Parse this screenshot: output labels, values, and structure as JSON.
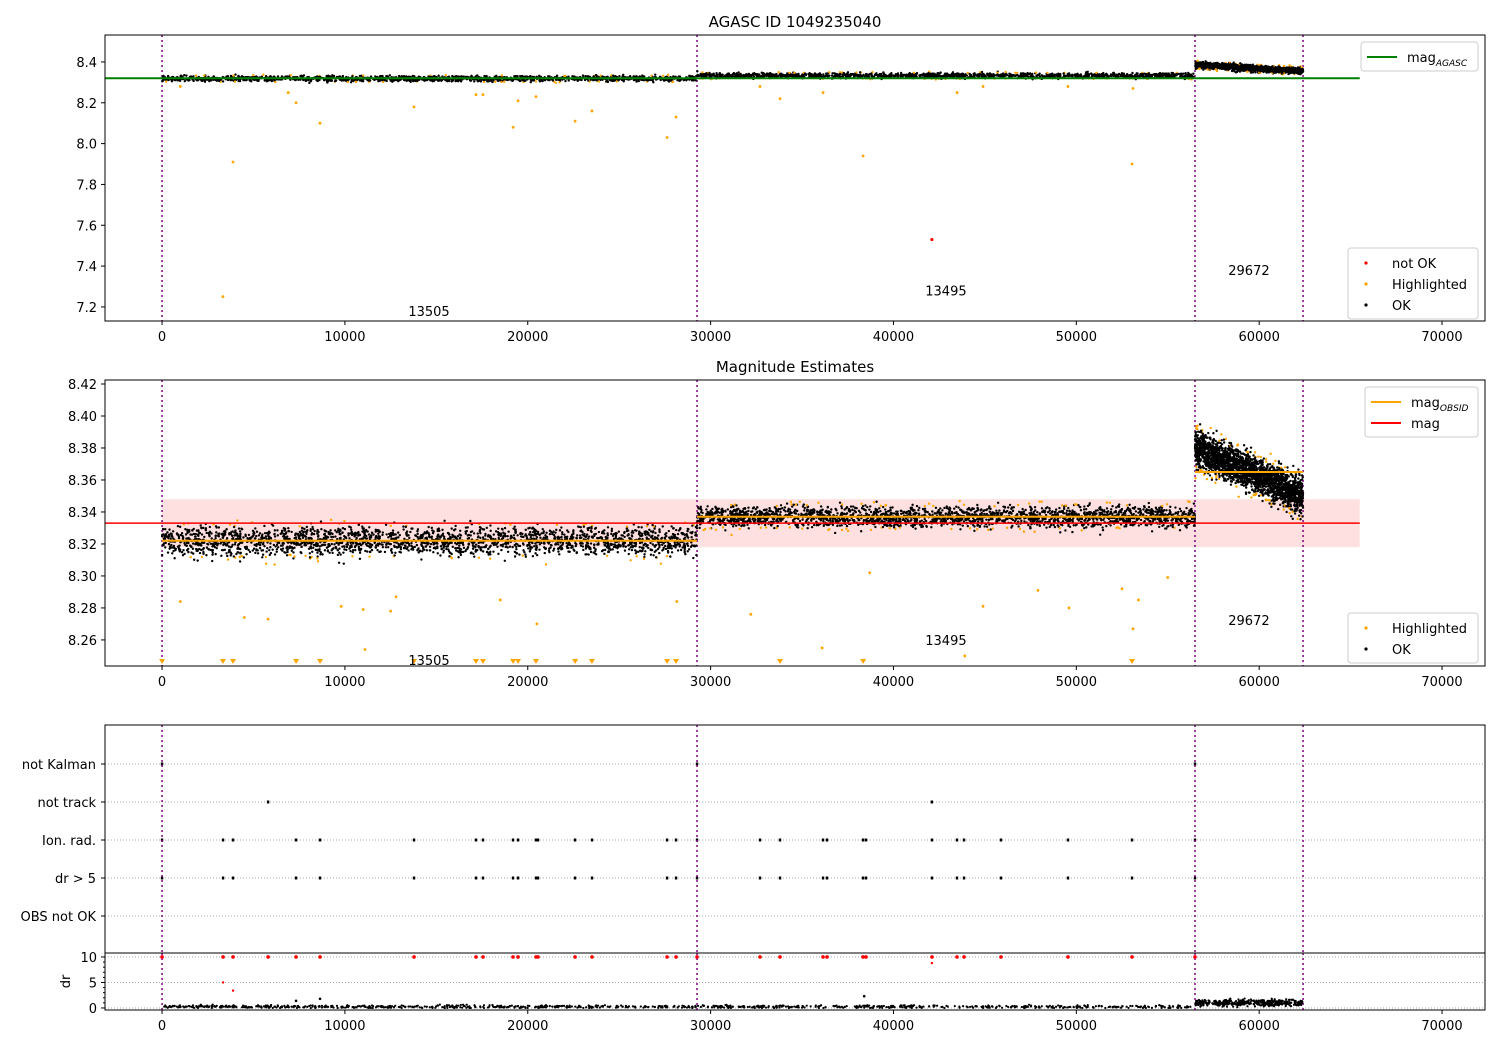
{
  "chart_data": [
    {
      "type": "scatter",
      "title": "AGASC ID 1049235040",
      "xlim": [
        -3120,
        72350
      ],
      "ylim": [
        7.131,
        8.532
      ],
      "xticks": [
        0,
        10000,
        20000,
        30000,
        40000,
        50000,
        60000,
        70000
      ],
      "xtick_labels": [
        "0",
        "10000",
        "20000",
        "30000",
        "40000",
        "50000",
        "60000",
        "70000"
      ],
      "yticks": [
        7.2,
        7.4,
        7.6,
        7.8,
        8.0,
        8.2,
        8.4
      ],
      "ytick_labels": [
        "7.2",
        "7.4",
        "7.6",
        "7.8",
        "8.0",
        "8.2",
        "8.4"
      ],
      "obsid_boundaries": [
        0,
        29257,
        56490,
        62400
      ],
      "obsids": [
        {
          "label": "13505",
          "x": 14600,
          "y": 7.18
        },
        {
          "label": "13495",
          "x": 42870,
          "y": 7.28
        },
        {
          "label": "29672",
          "x": 59440,
          "y": 7.38
        }
      ],
      "segments": [
        {
          "x0": 0,
          "x1": 29257,
          "mean": 8.318,
          "spread": 0.012
        },
        {
          "x0": 29257,
          "x1": 56490,
          "mean": 8.333,
          "spread": 0.012
        },
        {
          "x0": 56490,
          "x1": 62400,
          "mean_start": 8.385,
          "mean_end": 8.355,
          "spread": 0.014
        }
      ],
      "mag_agasc": {
        "value": 8.32,
        "x0": -3120,
        "x1": 65500,
        "color": "#008000"
      },
      "highlighted_outliers": [
        [
          3330,
          7.25
        ],
        [
          3880,
          7.91
        ],
        [
          8640,
          8.1
        ],
        [
          7330,
          8.2
        ],
        [
          19200,
          8.08
        ],
        [
          19470,
          8.21
        ],
        [
          20450,
          8.23
        ],
        [
          22590,
          8.11
        ],
        [
          23510,
          8.16
        ],
        [
          27620,
          8.03
        ],
        [
          28110,
          8.13
        ],
        [
          13780,
          8.18
        ],
        [
          17170,
          8.24
        ],
        [
          17550,
          8.24
        ],
        [
          32700,
          8.28
        ],
        [
          33800,
          8.22
        ],
        [
          36150,
          8.25
        ],
        [
          38340,
          7.94
        ],
        [
          43480,
          8.25
        ],
        [
          44900,
          8.28
        ],
        [
          53050,
          7.9
        ],
        [
          53100,
          8.27
        ],
        [
          49540,
          8.28
        ],
        [
          1000,
          8.28
        ],
        [
          6900,
          8.25
        ]
      ],
      "not_ok_points": [
        [
          42100,
          7.53
        ]
      ],
      "legend_upper": [
        {
          "label": "mag",
          "sub": "AGASC",
          "color": "#008000"
        }
      ],
      "legend_lower": [
        {
          "label": "not OK",
          "color": "#ff0000"
        },
        {
          "label": "Highlighted",
          "color": "#ffa500"
        },
        {
          "label": "OK",
          "color": "#000000"
        }
      ]
    },
    {
      "type": "scatter",
      "title": "Magnitude Estimates",
      "xlim": [
        -3120,
        72350
      ],
      "ylim": [
        8.2437,
        8.4225
      ],
      "xticks": [
        0,
        10000,
        20000,
        30000,
        40000,
        50000,
        60000,
        70000
      ],
      "xtick_labels": [
        "0",
        "10000",
        "20000",
        "30000",
        "40000",
        "50000",
        "60000",
        "70000"
      ],
      "yticks": [
        8.26,
        8.28,
        8.3,
        8.32,
        8.34,
        8.36,
        8.38,
        8.4,
        8.42
      ],
      "ytick_labels": [
        "8.26",
        "8.28",
        "8.30",
        "8.32",
        "8.34",
        "8.36",
        "8.38",
        "8.40",
        "8.42"
      ],
      "obsids": [
        {
          "label": "13505",
          "x": 14600,
          "y": 8.2475
        },
        {
          "label": "13495",
          "x": 42870,
          "y": 8.26
        },
        {
          "label": "29672",
          "x": 59440,
          "y": 8.2725
        }
      ],
      "segments": [
        {
          "x0": 0,
          "x1": 29257,
          "mean": 8.322,
          "spread": 0.008
        },
        {
          "x0": 29257,
          "x1": 56490,
          "mean": 8.337,
          "spread": 0.006
        },
        {
          "x0": 56490,
          "x1": 62400,
          "mean_start": 8.38,
          "mean_end": 8.35,
          "spread": 0.01
        }
      ],
      "mag_obsid": [
        {
          "x0": 0,
          "x1": 29257,
          "value": 8.322
        },
        {
          "x0": 29257,
          "x1": 56490,
          "value": 8.337
        },
        {
          "x0": 56490,
          "x1": 62400,
          "value": 8.365
        }
      ],
      "mag": {
        "value": 8.333,
        "band": [
          8.318,
          8.348
        ],
        "x0": -3120,
        "x1": 65500
      },
      "highlighted_below_range_x": [
        0,
        3330,
        3880,
        7330,
        8640,
        13780,
        17170,
        17550,
        19200,
        19470,
        20450,
        22590,
        23510,
        27620,
        28110,
        33800,
        38340,
        53050
      ],
      "highlighted_outliers": [
        [
          1000,
          8.284
        ],
        [
          4500,
          8.274
        ],
        [
          5800,
          8.273
        ],
        [
          9800,
          8.281
        ],
        [
          11000,
          8.279
        ],
        [
          11100,
          8.254
        ],
        [
          12800,
          8.287
        ],
        [
          12500,
          8.278
        ],
        [
          18500,
          8.285
        ],
        [
          20500,
          8.27
        ],
        [
          32200,
          8.276
        ],
        [
          36100,
          8.255
        ],
        [
          38700,
          8.302
        ],
        [
          43900,
          8.25
        ],
        [
          44900,
          8.281
        ],
        [
          47900,
          8.291
        ],
        [
          49600,
          8.28
        ],
        [
          52500,
          8.292
        ],
        [
          53100,
          8.267
        ],
        [
          53400,
          8.285
        ],
        [
          55000,
          8.299
        ],
        [
          28150,
          8.284
        ]
      ],
      "legend_upper": [
        {
          "label": "mag",
          "sub": "OBSID",
          "color": "#ffa500"
        },
        {
          "label": "mag",
          "sub": "",
          "color": "#ff0000"
        }
      ],
      "legend_lower": [
        {
          "label": "Highlighted",
          "color": "#ffa500"
        },
        {
          "label": "OK",
          "color": "#000000"
        }
      ]
    },
    {
      "type": "scatter",
      "title": "",
      "categories": [
        "not Kalman",
        "not track",
        "Ion. rad.",
        "dr > 5",
        "OBS not OK"
      ],
      "flags": {
        "not Kalman": [
          0,
          29257,
          56490
        ],
        "not track": [
          5800,
          42100
        ],
        "Ion. rad.": [
          0,
          3336,
          3883,
          7328,
          8640,
          13781,
          17171,
          17554,
          19195,
          19468,
          20452,
          20562,
          22586,
          23515,
          27617,
          28109,
          29257,
          32702,
          33796,
          36148,
          36366,
          38335,
          38499,
          42108,
          43475,
          43858,
          45881,
          49545,
          53045,
          56490
        ],
        "dr > 5": [
          0,
          3336,
          3883,
          7328,
          8640,
          13781,
          17171,
          17554,
          19195,
          19468,
          20452,
          20562,
          22586,
          23515,
          27617,
          28109,
          29257,
          32702,
          33796,
          36148,
          36366,
          38335,
          38499,
          42108,
          43475,
          43858,
          45881,
          49545,
          53045,
          56490
        ],
        "OBS not OK": []
      }
    },
    {
      "type": "scatter",
      "ylabel": "dr",
      "ylim": [
        -0.4,
        10.78
      ],
      "yticks": [
        0,
        5,
        10
      ],
      "ytick_labels": [
        "0",
        "5",
        "10"
      ],
      "xticks": [
        0,
        10000,
        20000,
        30000,
        40000,
        50000,
        60000,
        70000
      ],
      "xtick_labels": [
        "0",
        "10000",
        "20000",
        "30000",
        "40000",
        "50000",
        "60000",
        "70000"
      ],
      "clipped_points_x": [
        0,
        3336,
        3883,
        5800,
        7328,
        8640,
        13781,
        17171,
        17554,
        19195,
        19468,
        20452,
        20562,
        22586,
        23515,
        27617,
        28109,
        29257,
        32702,
        33796,
        36148,
        36366,
        38335,
        38499,
        42108,
        43475,
        43858,
        45881,
        49545,
        53045,
        56490
      ],
      "red_points": [
        [
          3336,
          5.0
        ],
        [
          3883,
          3.4
        ],
        [
          42100,
          8.8
        ]
      ],
      "black_outliers": [
        [
          7328,
          1.4
        ],
        [
          8640,
          1.8
        ],
        [
          38400,
          2.3
        ]
      ],
      "segments": [
        {
          "x0": 0,
          "x1": 56490,
          "mean": 0.25,
          "spread": 0.25
        },
        {
          "x0": 56490,
          "x1": 62400,
          "mean": 1.0,
          "spread": 0.5
        }
      ]
    }
  ]
}
